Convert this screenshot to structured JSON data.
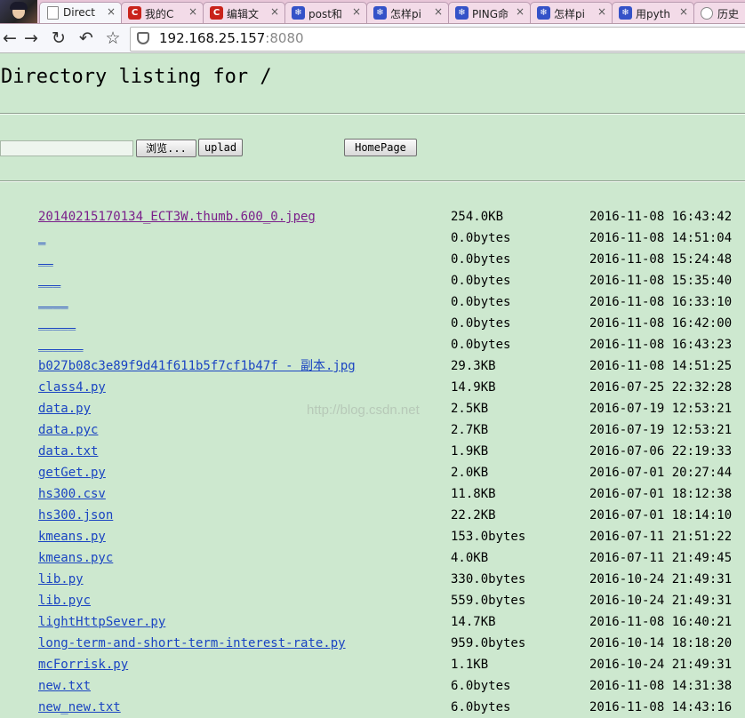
{
  "tabs": [
    {
      "title": "Directory listing for /",
      "display": "Direct",
      "icon": "document-icon",
      "active": true
    },
    {
      "title": "我的CSDN",
      "display": "我的C",
      "icon": "csdn-icon"
    },
    {
      "title": "编辑文章",
      "display": "编辑文",
      "icon": "csdn-icon"
    },
    {
      "title": "post和",
      "display": "post和",
      "icon": "baidu-paw-icon"
    },
    {
      "title": "怎样pi",
      "display": "怎样pi",
      "icon": "baidu-paw-icon"
    },
    {
      "title": "PING命",
      "display": "PING命",
      "icon": "baidu-paw-icon"
    },
    {
      "title": "怎样pi",
      "display": "怎样pi",
      "icon": "baidu-paw-icon"
    },
    {
      "title": "用pyth",
      "display": "用pyth",
      "icon": "baidu-paw-icon"
    },
    {
      "title": "历史",
      "display": "历史",
      "icon": "history-icon"
    }
  ],
  "address": {
    "host": "192.168.25.157",
    "port": ":8080"
  },
  "page": {
    "heading": "Directory listing for /",
    "browse_label": "浏览...",
    "upload_label": "uplad",
    "homepage_label": "HomePage"
  },
  "files": [
    {
      "name": "20140215170134_ECT3W.thumb.600_0.jpeg",
      "size": "254.0KB",
      "date": "2016-11-08 16:43:42",
      "visited": true
    },
    {
      "name": "_",
      "size": "0.0bytes",
      "date": "2016-11-08 14:51:04"
    },
    {
      "name": "__",
      "size": "0.0bytes",
      "date": "2016-11-08 15:24:48"
    },
    {
      "name": "___",
      "size": "0.0bytes",
      "date": "2016-11-08 15:35:40"
    },
    {
      "name": "____",
      "size": "0.0bytes",
      "date": "2016-11-08 16:33:10"
    },
    {
      "name": "_____",
      "size": "0.0bytes",
      "date": "2016-11-08 16:42:00"
    },
    {
      "name": "______",
      "size": "0.0bytes",
      "date": "2016-11-08 16:43:23"
    },
    {
      "name": "b027b08c3e89f9d41f611b5f7cf1b47f - 副本.jpg",
      "size": "29.3KB",
      "date": "2016-11-08 14:51:25"
    },
    {
      "name": "class4.py",
      "size": "14.9KB",
      "date": "2016-07-25 22:32:28"
    },
    {
      "name": "data.py",
      "size": "2.5KB",
      "date": "2016-07-19 12:53:21"
    },
    {
      "name": "data.pyc",
      "size": "2.7KB",
      "date": "2016-07-19 12:53:21"
    },
    {
      "name": "data.txt",
      "size": "1.9KB",
      "date": "2016-07-06 22:19:33"
    },
    {
      "name": "getGet.py",
      "size": "2.0KB",
      "date": "2016-07-01 20:27:44"
    },
    {
      "name": "hs300.csv",
      "size": "11.8KB",
      "date": "2016-07-01 18:12:38"
    },
    {
      "name": "hs300.json",
      "size": "22.2KB",
      "date": "2016-07-01 18:14:10"
    },
    {
      "name": "kmeans.py",
      "size": "153.0bytes",
      "date": "2016-07-11 21:51:22"
    },
    {
      "name": "kmeans.pyc",
      "size": "4.0KB",
      "date": "2016-07-11 21:49:45"
    },
    {
      "name": "lib.py",
      "size": "330.0bytes",
      "date": "2016-10-24 21:49:31"
    },
    {
      "name": "lib.pyc",
      "size": "559.0bytes",
      "date": "2016-10-24 21:49:31"
    },
    {
      "name": "lightHttpSever.py",
      "size": "14.7KB",
      "date": "2016-11-08 16:40:21"
    },
    {
      "name": "long-term-and-short-term-interest-rate.py",
      "size": "959.0bytes",
      "date": "2016-10-14 18:18:20"
    },
    {
      "name": "mcForrisk.py",
      "size": "1.1KB",
      "date": "2016-10-24 21:49:31"
    },
    {
      "name": "new.txt",
      "size": "6.0bytes",
      "date": "2016-11-08 14:31:38"
    },
    {
      "name": "new_new.txt",
      "size": "6.0bytes",
      "date": "2016-11-08 14:43:16"
    }
  ],
  "watermark": "http://blog.csdn.net"
}
